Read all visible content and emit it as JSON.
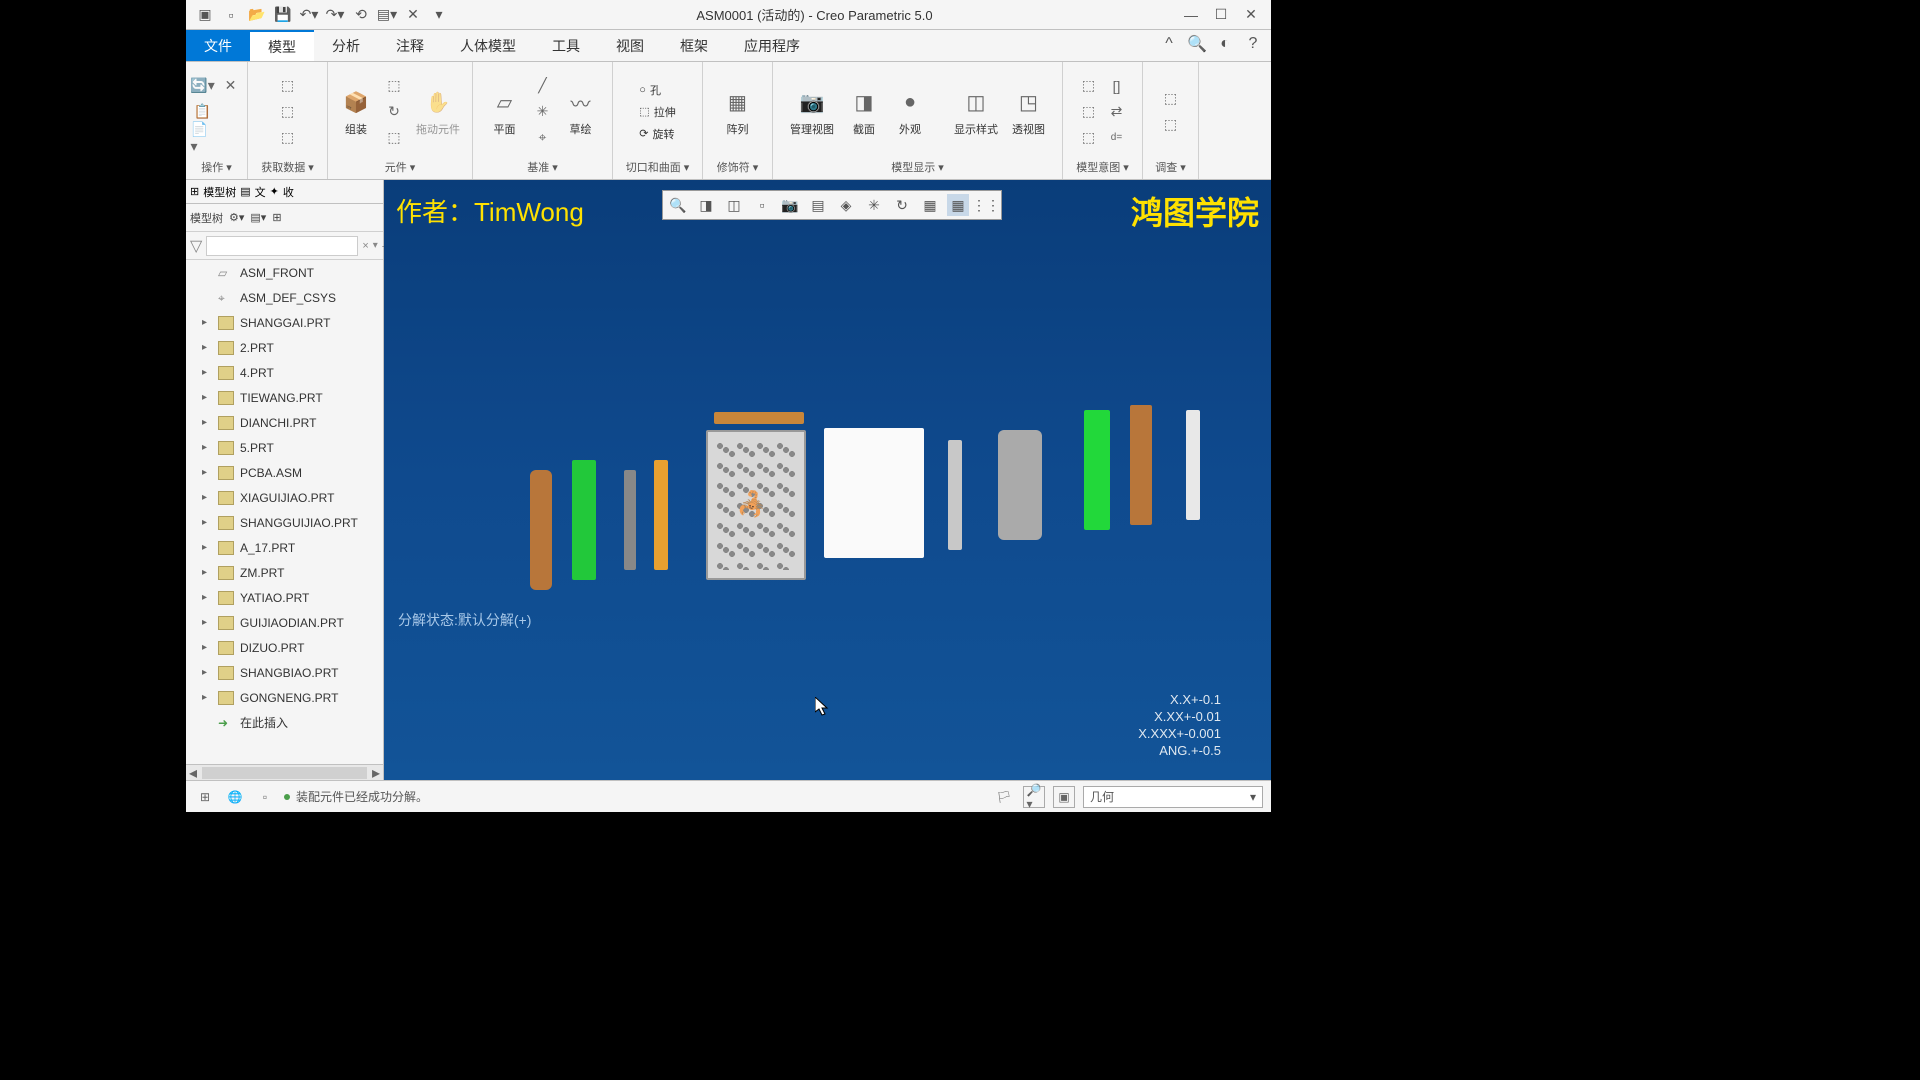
{
  "window": {
    "title": "ASM0001 (活动的) - Creo Parametric 5.0"
  },
  "menu": {
    "file": "文件",
    "model": "模型",
    "analysis": "分析",
    "annotate": "注释",
    "manikin": "人体模型",
    "tools": "工具",
    "view": "视图",
    "frame": "框架",
    "app": "应用程序"
  },
  "ribbon": {
    "g0_label": "操作 ▾",
    "g1_label": "获取数据 ▾",
    "assembly": "组装",
    "drag": "拖动元件",
    "g2_label": "元件 ▾",
    "plane": "平面",
    "sketch": "草绘",
    "g3_label": "基准 ▾",
    "hole": "孔",
    "extrude": "拉伸",
    "revolve": "旋转",
    "g4_label": "切口和曲面 ▾",
    "pattern": "阵列",
    "g5_label": "修饰符 ▾",
    "manage_view": "管理视图",
    "section": "截面",
    "appearance": "外观",
    "display_style": "显示样式",
    "perspective": "透视图",
    "g6_label": "模型显示 ▾",
    "g7_label": "模型意图 ▾",
    "g8_label": "调查 ▾",
    "d_eq": "d="
  },
  "sidebar": {
    "tree_tab": "模型树",
    "layers_tab": "文",
    "other_tab": "收",
    "tree_label": "模型树"
  },
  "tree": [
    {
      "type": "plane",
      "label": "ASM_FRONT"
    },
    {
      "type": "csys",
      "label": "ASM_DEF_CSYS"
    },
    {
      "type": "part",
      "label": "SHANGGAI.PRT"
    },
    {
      "type": "part",
      "label": "2.PRT"
    },
    {
      "type": "part",
      "label": "4.PRT"
    },
    {
      "type": "part",
      "label": "TIEWANG.PRT"
    },
    {
      "type": "part",
      "label": "DIANCHI.PRT"
    },
    {
      "type": "part",
      "label": "5.PRT"
    },
    {
      "type": "asm",
      "label": "PCBA.ASM"
    },
    {
      "type": "part",
      "label": "XIAGUIJIAO.PRT"
    },
    {
      "type": "part",
      "label": "SHANGGUIJIAO.PRT"
    },
    {
      "type": "part",
      "label": "A_17.PRT"
    },
    {
      "type": "part",
      "label": "ZM.PRT"
    },
    {
      "type": "part",
      "label": "YATIAO.PRT"
    },
    {
      "type": "part",
      "label": "GUIJIAODIAN.PRT"
    },
    {
      "type": "part",
      "label": "DIZUO.PRT"
    },
    {
      "type": "part",
      "label": "SHANGBIAO.PRT"
    },
    {
      "type": "part",
      "label": "GONGNENG.PRT"
    },
    {
      "type": "insert",
      "label": "在此插入"
    }
  ],
  "viewport": {
    "author": "作者：TimWong",
    "watermark": "鸿图学院",
    "explode_state": "分解状态:默认分解(+)",
    "tolerance": {
      "t1": "X.X+-0.1",
      "t2": "X.XX+-0.01",
      "t3": "X.XXX+-0.001",
      "t4": "ANG.+-0.5"
    }
  },
  "status": {
    "message": "装配元件已经成功分解。",
    "filter": "几何"
  }
}
